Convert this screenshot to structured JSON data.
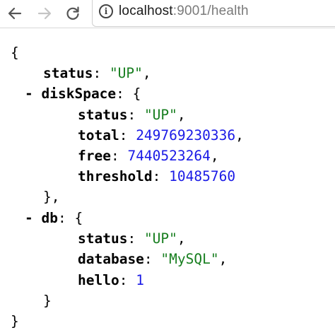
{
  "browser": {
    "url_host": "localhost",
    "url_rest": ":9001/health"
  },
  "json": {
    "status_key": "status",
    "status_value": "\"UP\"",
    "diskSpace": {
      "key": "diskSpace",
      "toggle": "-",
      "status_key": "status",
      "status_value": "\"UP\"",
      "total_key": "total",
      "total_value": "249769230336",
      "free_key": "free",
      "free_value": "7440523264",
      "threshold_key": "threshold",
      "threshold_value": "10485760"
    },
    "db": {
      "key": "db",
      "toggle": "-",
      "status_key": "status",
      "status_value": "\"UP\"",
      "database_key": "database",
      "database_value": "\"MySQL\"",
      "hello_key": "hello",
      "hello_value": "1"
    }
  },
  "colors": {
    "string": "#177e1f",
    "number": "#1a1ae6"
  },
  "icons": [
    "back-arrow-icon",
    "forward-arrow-icon",
    "reload-icon",
    "info-icon"
  ]
}
